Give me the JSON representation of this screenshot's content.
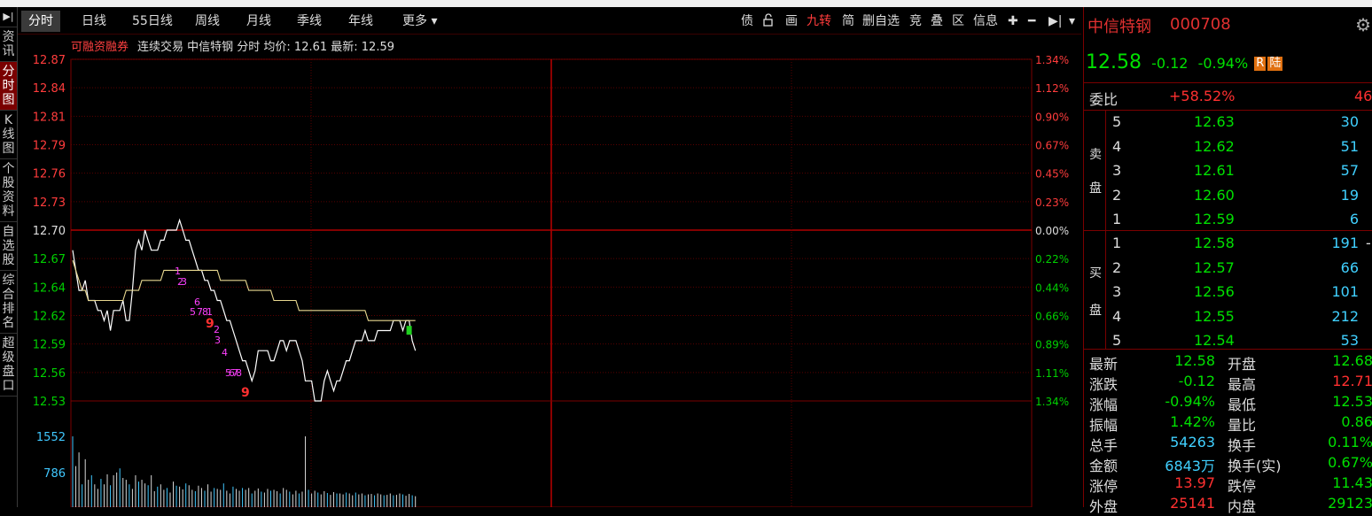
{
  "left_nav": {
    "toggle": "▶|",
    "items": [
      {
        "label": "资讯",
        "active": false
      },
      {
        "label": "分时图",
        "active": true
      },
      {
        "label": "K线图",
        "active": false
      },
      {
        "label": "个股资料",
        "active": false
      },
      {
        "label": "自选股",
        "active": false
      },
      {
        "label": "综合排名",
        "active": false
      },
      {
        "label": "超级盘口",
        "active": false
      }
    ]
  },
  "tabs": [
    "分时",
    "日线",
    "55日线",
    "周线",
    "月线",
    "季线",
    "年线",
    "更多 ▾"
  ],
  "toolbar": {
    "items": [
      "债",
      "画",
      "九转",
      "简",
      "删自选",
      "竞",
      "叠",
      "区",
      "信息"
    ],
    "plus": "✚",
    "minus": "━",
    "end": "▶|",
    "dropdown": "▾"
  },
  "info_line": {
    "margin_link": "可融资融券",
    "text": "连续交易 中信特钢 分时 均价: 12.61 最新: 12.59"
  },
  "chart_data": {
    "type": "line",
    "prev_close": 12.7,
    "y_ticks": [
      "12.87",
      "12.84",
      "12.81",
      "12.79",
      "12.76",
      "12.73",
      "12.70",
      "12.67",
      "12.64",
      "12.62",
      "12.59",
      "12.56",
      "12.53"
    ],
    "pct_ticks": [
      "1.34%",
      "1.12%",
      "0.90%",
      "0.67%",
      "0.45%",
      "0.23%",
      "0.00%",
      "0.22%",
      "0.44%",
      "0.66%",
      "0.89%",
      "1.11%",
      "1.34%"
    ],
    "volume_ticks": [
      "1552",
      "786"
    ],
    "price_series": [
      12.68,
      12.66,
      12.64,
      12.64,
      12.65,
      12.63,
      12.63,
      12.63,
      12.62,
      12.62,
      12.61,
      12.62,
      12.6,
      12.62,
      12.62,
      12.62,
      12.63,
      12.61,
      12.61,
      12.64,
      12.68,
      12.69,
      12.68,
      12.7,
      12.69,
      12.68,
      12.68,
      12.68,
      12.69,
      12.69,
      12.7,
      12.7,
      12.7,
      12.7,
      12.71,
      12.7,
      12.69,
      12.69,
      12.68,
      12.67,
      12.66,
      12.66,
      12.65,
      12.65,
      12.64,
      12.64,
      12.63,
      12.63,
      12.62,
      12.61,
      12.61,
      12.6,
      12.59,
      12.58,
      12.57,
      12.57,
      12.56,
      12.55,
      12.56,
      12.58,
      12.58,
      12.58,
      12.58,
      12.57,
      12.57,
      12.58,
      12.59,
      12.59,
      12.58,
      12.59,
      12.59,
      12.59,
      12.58,
      12.57,
      12.55,
      12.55,
      12.55,
      12.53,
      12.53,
      12.53,
      12.55,
      12.56,
      12.55,
      12.54,
      12.55,
      12.55,
      12.56,
      12.57,
      12.57,
      12.58,
      12.59,
      12.59,
      12.59,
      12.6,
      12.59,
      12.59,
      12.59,
      12.6,
      12.6,
      12.6,
      12.6,
      12.6,
      12.61,
      12.61,
      12.61,
      12.6,
      12.61,
      12.61,
      12.59,
      12.58
    ],
    "avg_series": [
      12.67,
      12.66,
      12.65,
      12.64,
      12.64,
      12.63,
      12.63,
      12.63,
      12.63,
      12.63,
      12.63,
      12.63,
      12.63,
      12.63,
      12.63,
      12.63,
      12.63,
      12.64,
      12.64,
      12.64,
      12.64,
      12.64,
      12.65,
      12.65,
      12.65,
      12.65,
      12.65,
      12.65,
      12.65,
      12.66,
      12.66,
      12.66,
      12.66,
      12.66,
      12.66,
      12.66,
      12.66,
      12.66,
      12.66,
      12.66,
      12.66,
      12.66,
      12.66,
      12.66,
      12.66,
      12.66,
      12.66,
      12.65,
      12.65,
      12.65,
      12.65,
      12.65,
      12.65,
      12.65,
      12.65,
      12.65,
      12.64,
      12.64,
      12.64,
      12.64,
      12.64,
      12.64,
      12.64,
      12.64,
      12.63,
      12.63,
      12.63,
      12.63,
      12.63,
      12.63,
      12.63,
      12.63,
      12.62,
      12.62,
      12.62,
      12.62,
      12.62,
      12.62,
      12.62,
      12.62,
      12.62,
      12.62,
      12.62,
      12.62,
      12.62,
      12.62,
      12.62,
      12.62,
      12.62,
      12.62,
      12.62,
      12.62,
      12.62,
      12.62,
      12.61,
      12.61,
      12.61,
      12.61,
      12.61,
      12.61,
      12.61,
      12.61,
      12.61,
      12.61,
      12.61,
      12.61,
      12.61,
      12.61,
      12.61,
      12.61
    ],
    "volume_series": [
      1552,
      900,
      1200,
      500,
      1050,
      600,
      700,
      500,
      400,
      620,
      500,
      720,
      480,
      700,
      760,
      850,
      640,
      600,
      500,
      400,
      700,
      560,
      600,
      520,
      480,
      700,
      350,
      450,
      500,
      380,
      420,
      320,
      560,
      470,
      450,
      390,
      520,
      480,
      380,
      350,
      470,
      420,
      360,
      500,
      340,
      420,
      400,
      380,
      520,
      360,
      300,
      450,
      400,
      360,
      420,
      380,
      420,
      300,
      360,
      410,
      340,
      320,
      400,
      360,
      380,
      350,
      300,
      420,
      380,
      340,
      280,
      360,
      300,
      340,
      1552,
      380,
      300,
      360,
      320,
      280,
      350,
      310,
      270,
      330,
      300,
      300,
      280,
      320,
      300,
      260,
      320,
      280,
      300,
      260,
      280,
      290,
      260,
      300,
      280,
      260,
      270,
      300,
      260,
      270,
      300,
      280,
      250,
      290,
      260,
      240
    ],
    "nine_turn_marks": [
      "1",
      "2",
      "3",
      "6",
      "5",
      "7",
      "8",
      "1",
      "9",
      "2",
      "3",
      "4",
      "5",
      "6",
      "7",
      "8",
      "9"
    ]
  },
  "right_panel": {
    "name": "中信特钢",
    "code": "000708",
    "gear": "⚙",
    "price": "12.58",
    "change": "-0.12",
    "change_pct": "-0.94%",
    "badge_r": "R",
    "badge_lu": "陆",
    "weibi_label": "委比",
    "weibi_value": "+58.52%",
    "weibi_extra": "46",
    "sell_label": [
      "卖",
      "盘"
    ],
    "buy_label": [
      "买",
      "盘"
    ],
    "sells": [
      {
        "lvl": "5",
        "price": "12.63",
        "vol": "30"
      },
      {
        "lvl": "4",
        "price": "12.62",
        "vol": "51"
      },
      {
        "lvl": "3",
        "price": "12.61",
        "vol": "57"
      },
      {
        "lvl": "2",
        "price": "12.60",
        "vol": "19"
      },
      {
        "lvl": "1",
        "price": "12.59",
        "vol": "6"
      }
    ],
    "buys": [
      {
        "lvl": "1",
        "price": "12.58",
        "vol": "191",
        "extra": "-"
      },
      {
        "lvl": "2",
        "price": "12.57",
        "vol": "66",
        "extra": ""
      },
      {
        "lvl": "3",
        "price": "12.56",
        "vol": "101",
        "extra": ""
      },
      {
        "lvl": "4",
        "price": "12.55",
        "vol": "212",
        "extra": ""
      },
      {
        "lvl": "5",
        "price": "12.54",
        "vol": "53",
        "extra": ""
      }
    ],
    "stats": [
      {
        "l1": "最新",
        "v1": "12.58",
        "c1": "grn",
        "l2": "开盘",
        "v2": "12.68",
        "c2": "grn"
      },
      {
        "l1": "涨跌",
        "v1": "-0.12",
        "c1": "grn",
        "l2": "最高",
        "v2": "12.71",
        "c2": "red"
      },
      {
        "l1": "涨幅",
        "v1": "-0.94%",
        "c1": "grn",
        "l2": "最低",
        "v2": "12.53",
        "c2": "grn"
      },
      {
        "l1": "振幅",
        "v1": "1.42%",
        "c1": "grn",
        "l2": "量比",
        "v2": "0.86",
        "c2": "grn"
      },
      {
        "l1": "总手",
        "v1": "54263",
        "c1": "cyan",
        "l2": "换手",
        "v2": "0.11%",
        "c2": "grn"
      },
      {
        "l1": "金额",
        "v1": "6843万",
        "c1": "cyan",
        "l2": "换手(实)",
        "v2": "0.67%",
        "c2": "grn"
      },
      {
        "l1": "涨停",
        "v1": "13.97",
        "c1": "red",
        "l2": "跌停",
        "v2": "11.43",
        "c2": "grn"
      },
      {
        "l1": "外盘",
        "v1": "25141",
        "c1": "red",
        "l2": "内盘",
        "v2": "29123",
        "c2": "grn"
      }
    ]
  }
}
